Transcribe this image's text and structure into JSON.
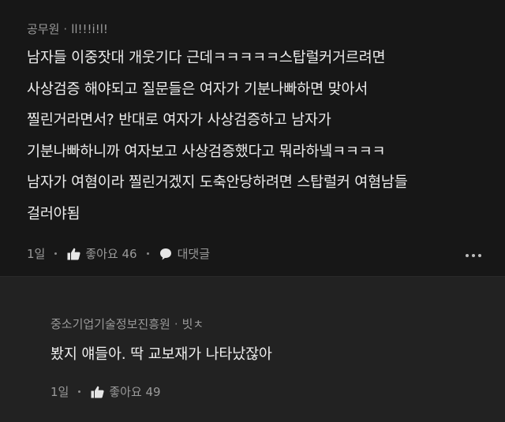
{
  "comments": [
    {
      "author": "공무원",
      "nickname": "ll!!!i!l!",
      "lines": [
        "남자들 이중잣대 개웃기다 근데ㅋㅋㅋㅋㅋ스탑럴커거르려면",
        "사상검증 해야되고 질문들은 여자가 기분나빠하면 맞아서",
        "찔린거라면서? 반대로 여자가 사상검증하고 남자가",
        "기분나빠하니까 여자보고 사상검증했다고 뭐라하넼ㅋㅋㅋㅋ",
        "남자가 여혐이라 찔린거겠지 도축안당하려면 스탑럴커 여혐남들",
        "걸러야됨"
      ],
      "time": "1일",
      "like_label": "좋아요 46",
      "reply_label": "대댓글"
    },
    {
      "author": "중소기업기술정보진흥원",
      "nickname": "빗ㅊ",
      "lines": [
        "봤지 얘들아. 딱 교보재가 나타났잖아"
      ],
      "time": "1일",
      "like_label": "좋아요 49"
    }
  ]
}
